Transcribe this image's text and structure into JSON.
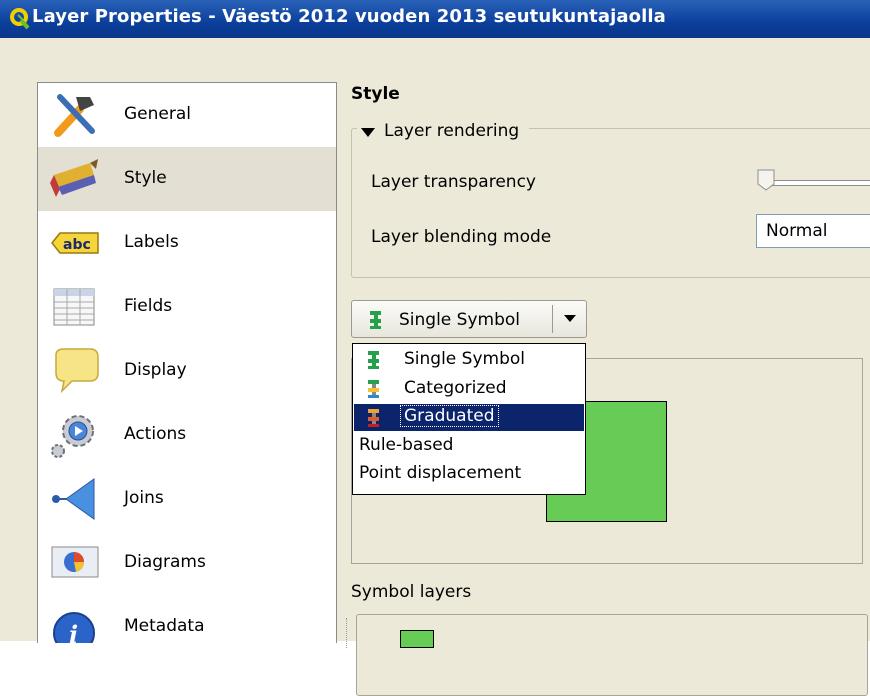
{
  "window": {
    "title": "Layer Properties - Väestö 2012 vuoden 2013 seutukuntajaolla"
  },
  "sidebar": {
    "items": [
      {
        "label": "General",
        "icon": "tools-icon"
      },
      {
        "label": "Style",
        "icon": "paintbrush-icon",
        "selected": true
      },
      {
        "label": "Labels",
        "icon": "abc-label-icon"
      },
      {
        "label": "Fields",
        "icon": "table-icon"
      },
      {
        "label": "Display",
        "icon": "speech-bubble-icon"
      },
      {
        "label": "Actions",
        "icon": "gears-icon"
      },
      {
        "label": "Joins",
        "icon": "join-arrow-icon"
      },
      {
        "label": "Diagrams",
        "icon": "pie-chart-icon"
      },
      {
        "label": "Metadata",
        "icon": "info-icon"
      }
    ]
  },
  "style": {
    "heading": "Style",
    "layer_rendering": {
      "title": "Layer rendering",
      "transparency_label": "Layer transparency",
      "transparency_value": 0,
      "blending_label": "Layer blending mode",
      "blending_value": "Normal"
    },
    "renderer": {
      "selected": "Single Symbol",
      "options": [
        {
          "label": "Single Symbol",
          "icon": "single-symbol-icon"
        },
        {
          "label": "Categorized",
          "icon": "categorized-icon"
        },
        {
          "label": "Graduated",
          "icon": "graduated-icon",
          "highlighted": true
        },
        {
          "label": "Rule-based",
          "icon": ""
        },
        {
          "label": "Point displacement",
          "icon": ""
        }
      ]
    },
    "symbol_color": "#66cc55",
    "symbol_layers_label": "Symbol layers"
  },
  "colors": {
    "titlebar": "#0b3f9b",
    "window_bg": "#ece9d8",
    "highlight": "#0b246b"
  }
}
